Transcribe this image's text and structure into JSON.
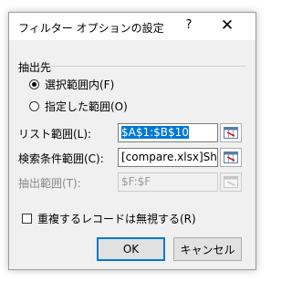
{
  "dialog": {
    "title": "フィルター オプションの設定",
    "help_label": "?",
    "close_label": "✕"
  },
  "output": {
    "section_label": "抽出先",
    "options": [
      {
        "label": "選択範囲内(F)",
        "checked": true
      },
      {
        "label": "指定した範囲(O)",
        "checked": false
      }
    ]
  },
  "fields": {
    "list_range": {
      "label": "リスト範囲(L):",
      "value": "$A$1:$B$10"
    },
    "criteria_range": {
      "label": "検索条件範囲(C):",
      "value": "[compare.xlsx]She"
    },
    "extract_range": {
      "label": "抽出範囲(T):",
      "value": "$F:$F"
    }
  },
  "unique": {
    "label": "重複するレコードは無視する(R)",
    "checked": false
  },
  "buttons": {
    "ok": "OK",
    "cancel": "キャンセル"
  },
  "icons": {
    "range_picker": "range-select-icon",
    "help": "help-icon",
    "close": "close-icon"
  }
}
